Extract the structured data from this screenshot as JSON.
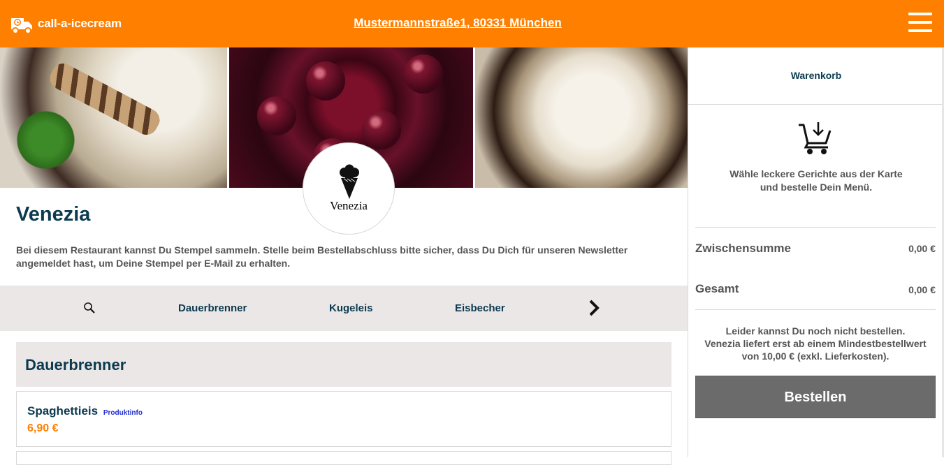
{
  "header": {
    "brand": "call-a-icecream",
    "address": "Mustermannstraße1, 80331 München",
    "brand_color": "#ff7f00"
  },
  "hero": {
    "logo_text": "Venezia"
  },
  "restaurant": {
    "name": "Venezia",
    "description": "Bei diesem Restaurant kannst Du Stempel sammeln. Stelle beim Bestellabschluss bitte sicher, dass Du Dich für unseren Newsletter angemeldet hast, um Deine Stempel per E-Mail zu erhalten."
  },
  "category_nav": {
    "items": [
      "Dauerbrenner",
      "Kugeleis",
      "Eisbecher"
    ]
  },
  "menu": {
    "section_title": "Dauerbrenner",
    "items": [
      {
        "name": "Spaghettieis",
        "info": "Produktinfo",
        "price": "6,90 €"
      }
    ]
  },
  "cart": {
    "title": "Warenkorb",
    "empty_line1": "Wähle leckere Gerichte aus der Karte",
    "empty_line2": "und bestelle Dein Menü.",
    "subtotal_label": "Zwischensumme",
    "subtotal_value": "0,00 €",
    "total_label": "Gesamt",
    "total_value": "0,00 €",
    "note_line1": "Leider kannst Du noch nicht bestellen.",
    "note_line2": "Venezia liefert erst ab einem Mindestbestellwert",
    "note_line3": "von 10,00 € (exkl. Lieferkosten).",
    "order_button": "Bestellen"
  }
}
